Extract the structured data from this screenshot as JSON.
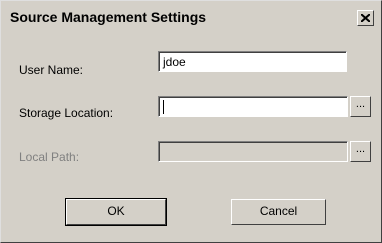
{
  "window": {
    "title": "Source Management Settings",
    "close_glyph": "✕"
  },
  "form": {
    "user_name": {
      "label": "User Name:",
      "value": "jdoe"
    },
    "storage_location": {
      "label": "Storage Location:",
      "value": "",
      "browse_label": "..."
    },
    "local_path": {
      "label": "Local Path:",
      "value": "",
      "browse_label": "...",
      "disabled": true
    }
  },
  "buttons": {
    "ok_label": "OK",
    "cancel_label": "Cancel"
  }
}
